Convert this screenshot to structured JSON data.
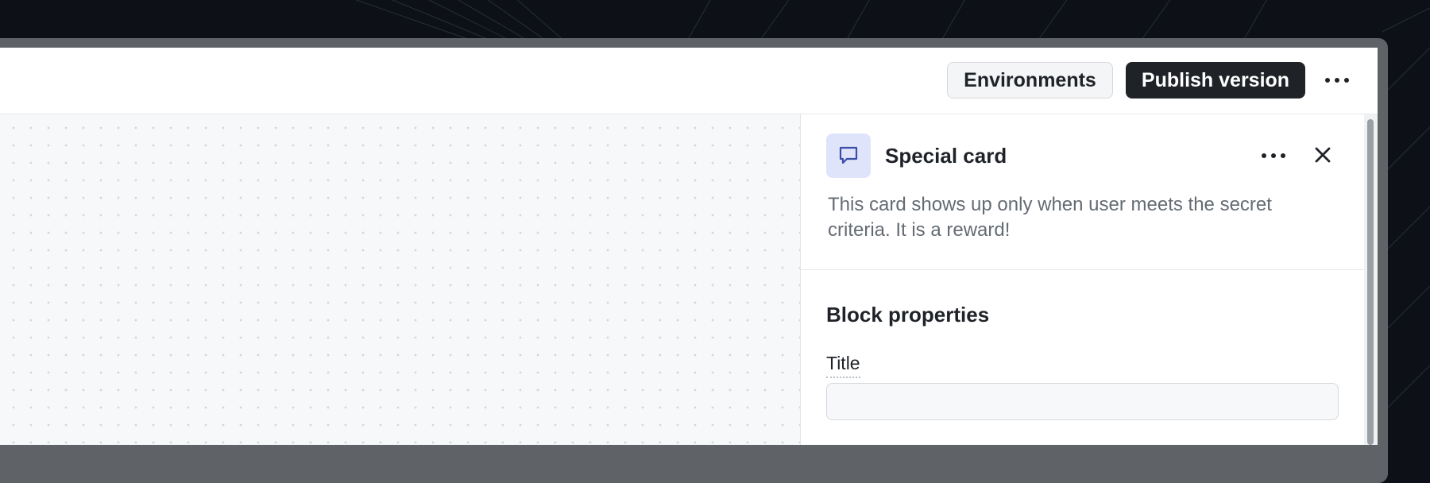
{
  "topbar": {
    "environments_label": "Environments",
    "publish_label": "Publish version",
    "more_icon": "more-horizontal-icon"
  },
  "panel": {
    "icon": "chat-bubble-icon",
    "title": "Special card",
    "description": "This card shows up only when user meets the secret criteria. It is a reward!",
    "more_icon": "more-horizontal-icon",
    "close_icon": "close-icon",
    "section_title": "Block properties",
    "field": {
      "label": "Title",
      "value": "",
      "placeholder": ""
    }
  },
  "colors": {
    "publish_bg": "#1f2328",
    "icon_tile_bg": "#dfe4fb",
    "icon_accent": "#3b4ea8"
  }
}
